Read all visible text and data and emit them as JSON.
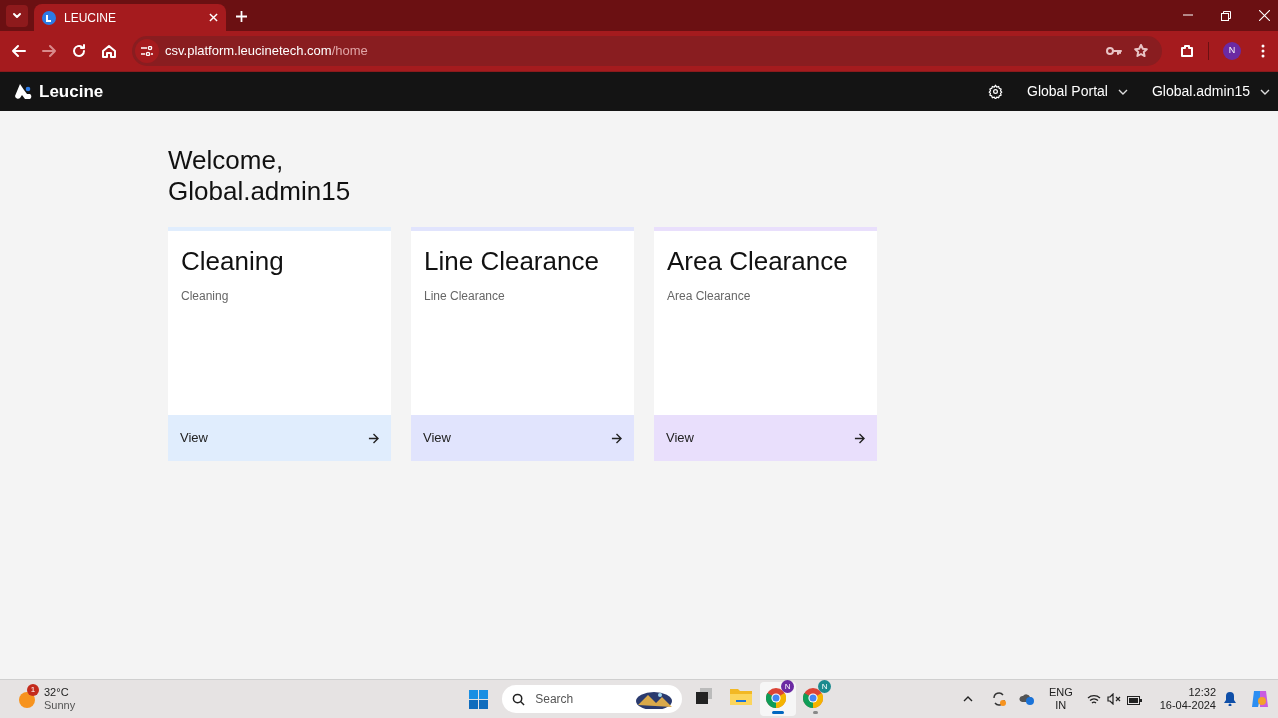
{
  "browser": {
    "tab": {
      "title": "LEUCINE"
    },
    "url": {
      "host": "csv.platform.leucinetech.com",
      "path": "/home"
    },
    "profile_initial": "N"
  },
  "app": {
    "brand": "Leucine",
    "portal": "Global Portal",
    "user": "Global.admin15"
  },
  "welcome": [
    "Welcome,",
    "Global.admin15"
  ],
  "cards": [
    {
      "title": "Cleaning",
      "subtitle": "Cleaning",
      "action": "View",
      "color": "#e0edfd"
    },
    {
      "title": "Line Clearance",
      "subtitle": "Line Clearance",
      "action": "View",
      "color": "#e1e4fd"
    },
    {
      "title": "Area Clearance",
      "subtitle": "Area Clearance",
      "action": "View",
      "color": "#e9dffc"
    }
  ],
  "taskbar": {
    "weather": {
      "badge": "1",
      "temperature": "32°C",
      "condition": "Sunny"
    },
    "search": {
      "placeholder": "Search"
    },
    "apps": [
      {
        "kind": "task-view",
        "selected": false
      },
      {
        "kind": "folder",
        "selected": false
      },
      {
        "kind": "browser",
        "badge": "N",
        "selected": true
      },
      {
        "kind": "browser",
        "badge": "N",
        "selected": false
      }
    ],
    "language": [
      "ENG",
      "IN"
    ],
    "time": "12:32",
    "date": "16-04-2024"
  }
}
